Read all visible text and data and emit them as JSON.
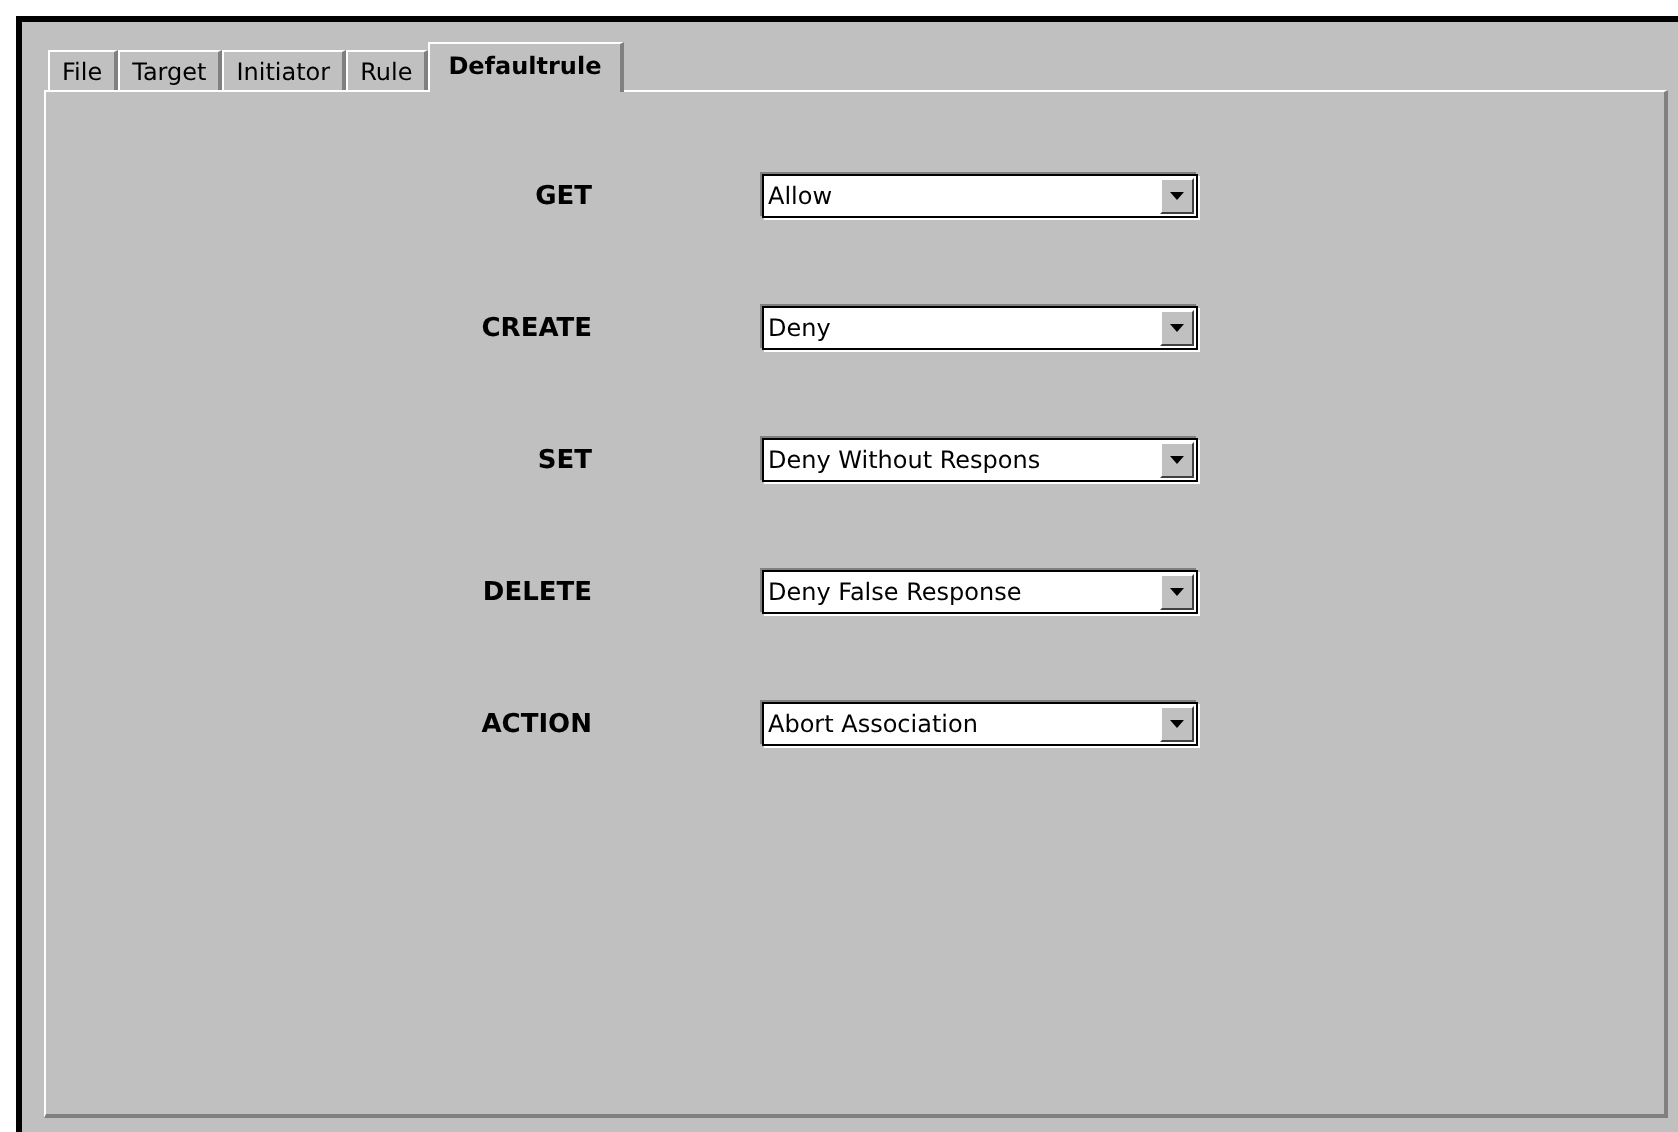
{
  "tabs": [
    {
      "label": "File",
      "selected": false
    },
    {
      "label": "Target",
      "selected": false
    },
    {
      "label": "Initiator",
      "selected": false
    },
    {
      "label": "Rule",
      "selected": false
    },
    {
      "label": "Defaultrule",
      "selected": true
    }
  ],
  "rules": [
    {
      "label": "GET",
      "value": "Allow"
    },
    {
      "label": "CREATE",
      "value": "Deny"
    },
    {
      "label": "SET",
      "value": "Deny Without Respons"
    },
    {
      "label": "DELETE",
      "value": "Deny False Response"
    },
    {
      "label": "ACTION",
      "value": "Abort Association"
    }
  ]
}
